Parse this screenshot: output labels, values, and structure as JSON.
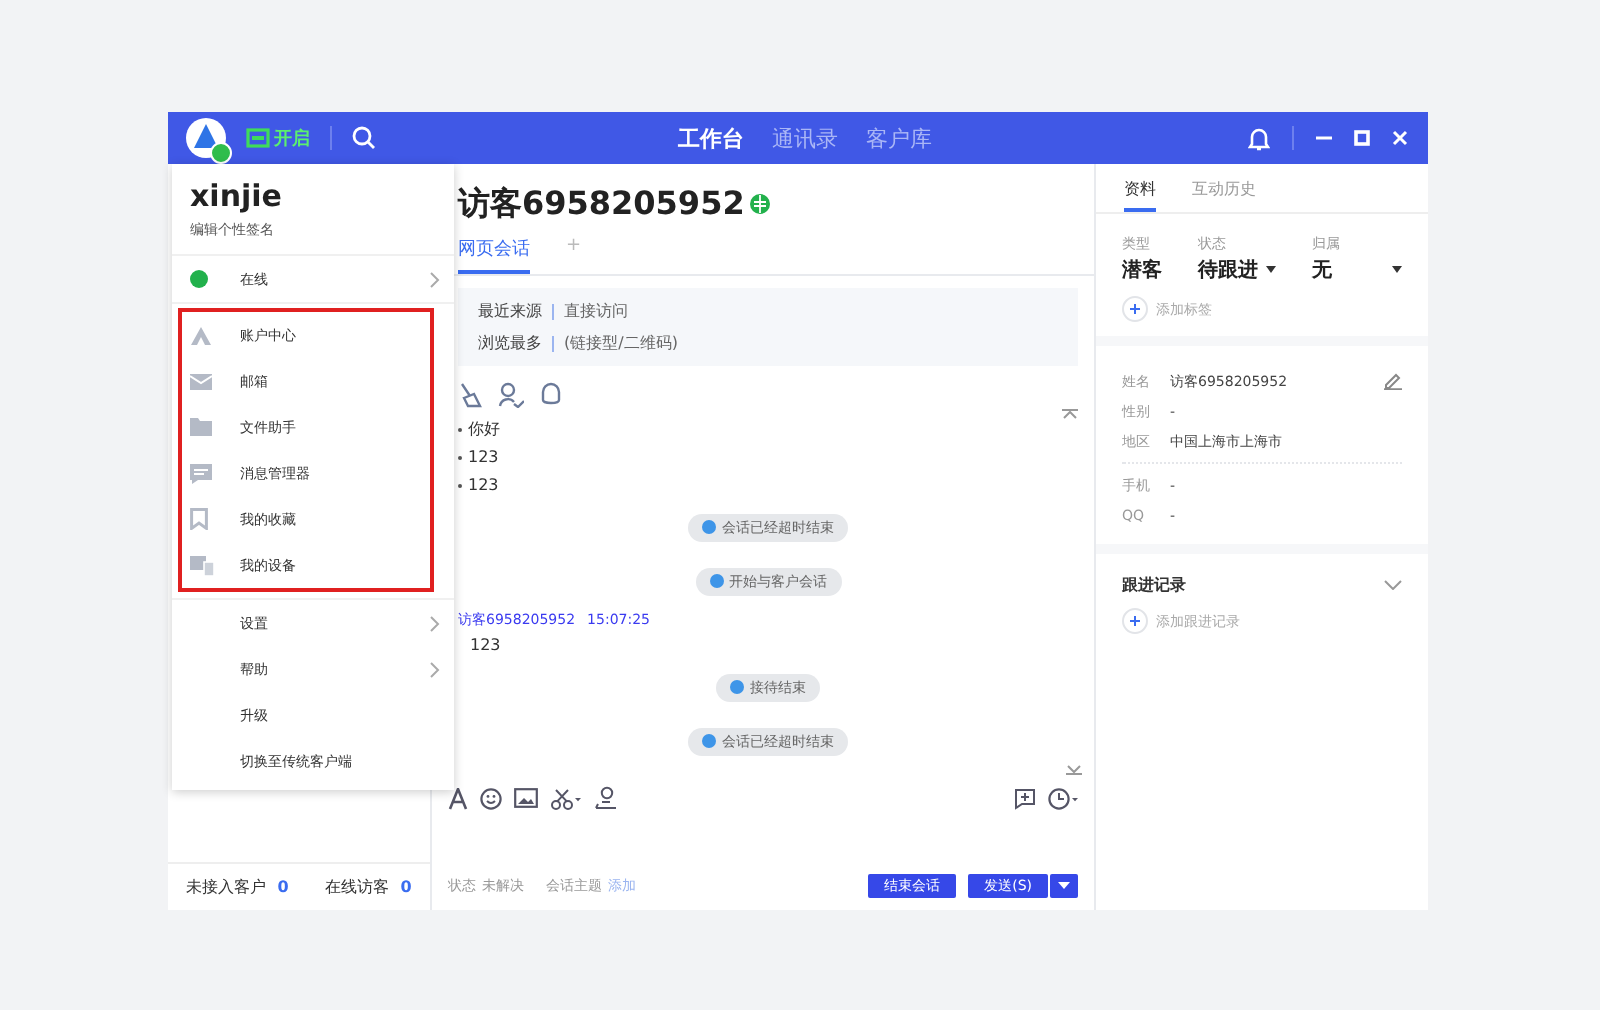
{
  "header": {
    "status_label": "开启",
    "nav": [
      {
        "label": "工作台",
        "selected": true
      },
      {
        "label": "通讯录",
        "selected": false
      },
      {
        "label": "客户库",
        "selected": false
      }
    ]
  },
  "menu": {
    "user": "xinjie",
    "signature": "编辑个性签名",
    "status": {
      "label": "在线",
      "arrow": true
    },
    "highlighted": [
      {
        "kind": "account",
        "label": "账户中心"
      },
      {
        "kind": "mail",
        "label": "邮箱"
      },
      {
        "kind": "folder",
        "label": "文件助手"
      },
      {
        "kind": "message",
        "label": "消息管理器"
      },
      {
        "kind": "bookmark",
        "label": "我的收藏"
      },
      {
        "kind": "device",
        "label": "我的设备"
      }
    ],
    "items": [
      {
        "label": "设置",
        "arrow": true
      },
      {
        "label": "帮助",
        "arrow": true
      },
      {
        "label": "升级",
        "arrow": false
      },
      {
        "label": "切换至传统客户端",
        "arrow": false
      }
    ]
  },
  "sidebar": {
    "counters": [
      {
        "label": "未接入客户",
        "count": "0"
      },
      {
        "label": "在线访客",
        "count": "0"
      }
    ]
  },
  "conversation": {
    "title": "访客6958205952",
    "tabs": [
      {
        "label": "网页会话",
        "selected": true
      },
      {
        "label": "+",
        "selected": false
      }
    ],
    "info": [
      {
        "label": "最近来源",
        "value": "直接访问"
      },
      {
        "label": "浏览最多",
        "value": "(链接型/二维码)"
      }
    ],
    "messages": [
      {
        "kind": "line",
        "text": "你好"
      },
      {
        "kind": "line",
        "text": "123"
      },
      {
        "kind": "line",
        "text": "123"
      },
      {
        "kind": "notice",
        "text": "会话已经超时结束"
      },
      {
        "kind": "notice",
        "text": "开始与客户会话"
      },
      {
        "kind": "author",
        "text": "访客6958205952",
        "time": "15:07:25"
      },
      {
        "kind": "reply",
        "text": "123"
      },
      {
        "kind": "notice",
        "text": "接待结束"
      },
      {
        "kind": "notice",
        "text": "会话已经超时结束"
      }
    ],
    "status_label": "状态",
    "status_value": "未解决",
    "topic_label": "会话主题",
    "topic_link": "添加",
    "end_button": "结束会话",
    "send_button": "发送(S)"
  },
  "profile": {
    "tabs": [
      {
        "label": "资料",
        "selected": true
      },
      {
        "label": "互动历史",
        "selected": false
      }
    ],
    "attributes": [
      {
        "label": "类型",
        "value": "潜客",
        "dropdown": false
      },
      {
        "label": "状态",
        "value": "待跟进",
        "dropdown": true
      },
      {
        "label": "归属",
        "value": "无",
        "dropdown": true
      }
    ],
    "add_tag": "添加标签",
    "fields": [
      {
        "label": "姓名",
        "value": "访客6958205952"
      },
      {
        "label": "性别",
        "value": "-"
      },
      {
        "label": "地区",
        "value": "中国上海市上海市"
      }
    ],
    "contacts": [
      {
        "label": "手机",
        "value": "-"
      },
      {
        "label": "QQ",
        "value": "-"
      }
    ],
    "followup_title": "跟进记录",
    "add_followup": "添加跟进记录"
  }
}
